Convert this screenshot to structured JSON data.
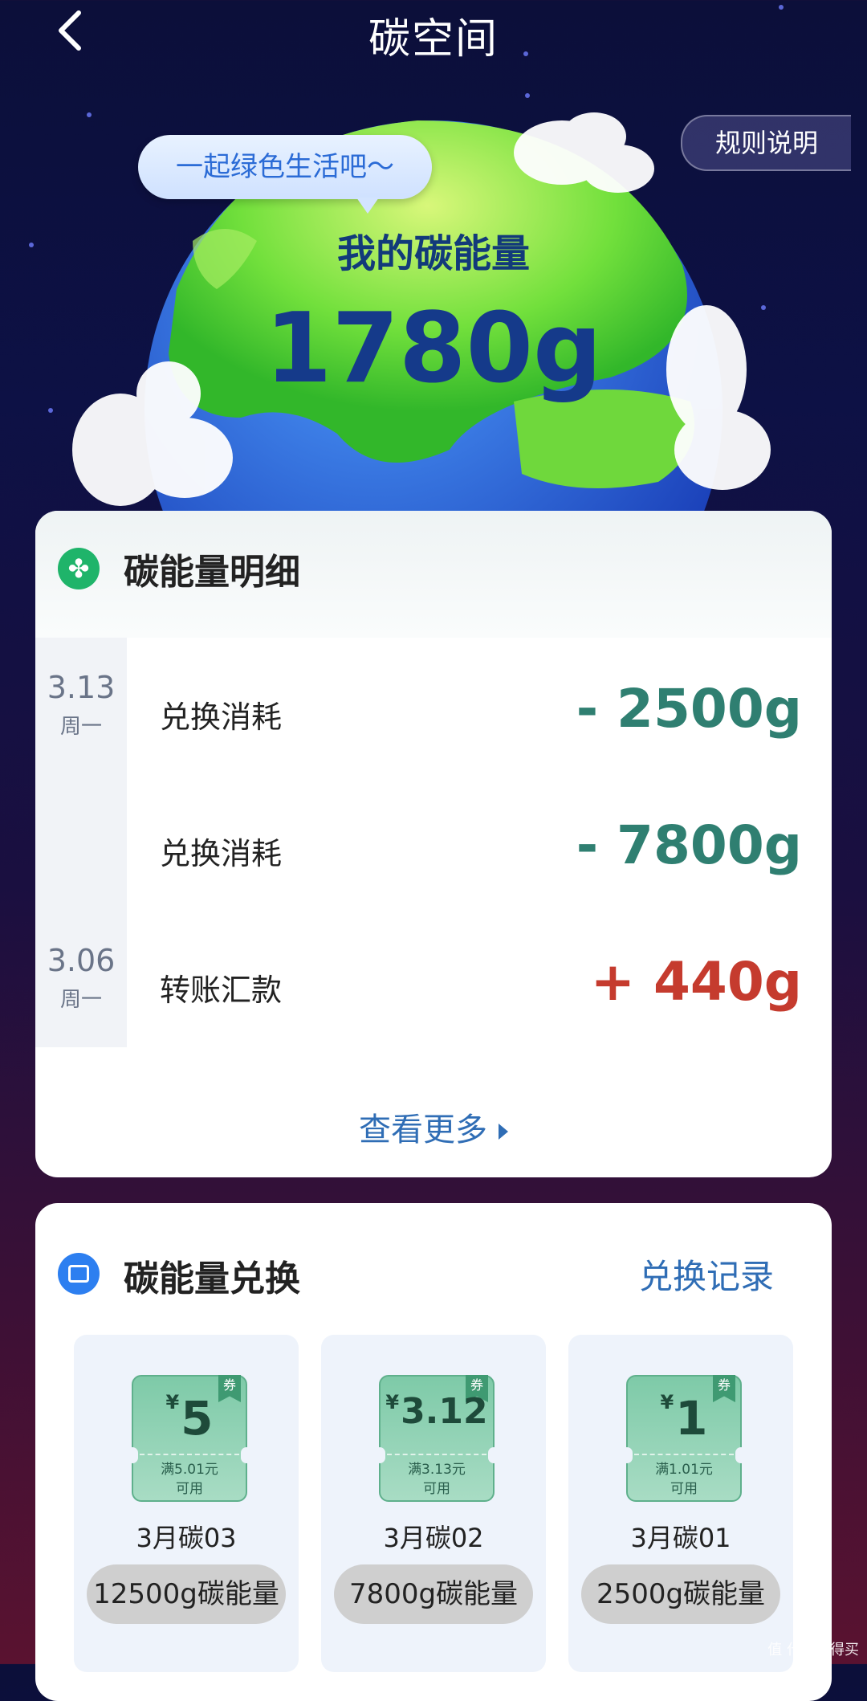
{
  "header": {
    "title": "碳空间",
    "rules_label": "规则说明"
  },
  "hero": {
    "bubble_text": "一起绿色生活吧～",
    "energy_label": "我的碳能量",
    "energy_value": "1780g"
  },
  "detail": {
    "title": "碳能量明细",
    "dates": [
      {
        "date": "3.13",
        "weekday": "周一"
      },
      {
        "date": "3.06",
        "weekday": "周一"
      }
    ],
    "rows": [
      {
        "label": "兑换消耗",
        "value": "- 2500g",
        "type": "minus"
      },
      {
        "label": "兑换消耗",
        "value": "- 7800g",
        "type": "minus"
      },
      {
        "label": "转账汇款",
        "value": "+ 440g",
        "type": "plus"
      }
    ],
    "more_label": "查看更多"
  },
  "exchange": {
    "title": "碳能量兑换",
    "record_label": "兑换记录",
    "items": [
      {
        "currency": "¥",
        "amount": "5",
        "condition_line1": "满5.01元",
        "condition_line2": "可用",
        "tag": "券",
        "name": "3月碳03",
        "price": "12500g碳能量"
      },
      {
        "currency": "¥",
        "amount": "3.12",
        "condition_line1": "满3.13元",
        "condition_line2": "可用",
        "tag": "券",
        "name": "3月碳02",
        "price": "7800g碳能量"
      },
      {
        "currency": "¥",
        "amount": "1",
        "condition_line1": "满1.01元",
        "condition_line2": "可用",
        "tag": "券",
        "name": "3月碳01",
        "price": "2500g碳能量"
      }
    ]
  },
  "watermark": "值 什么值得买",
  "colors": {
    "minus": "#2f7f71",
    "plus": "#c53b2e",
    "link": "#2f6db5"
  },
  "icons": [
    "back-arrow-icon",
    "clover-icon",
    "shopping-bag-icon",
    "chevron-right-icon",
    "coupon-tag-icon"
  ]
}
